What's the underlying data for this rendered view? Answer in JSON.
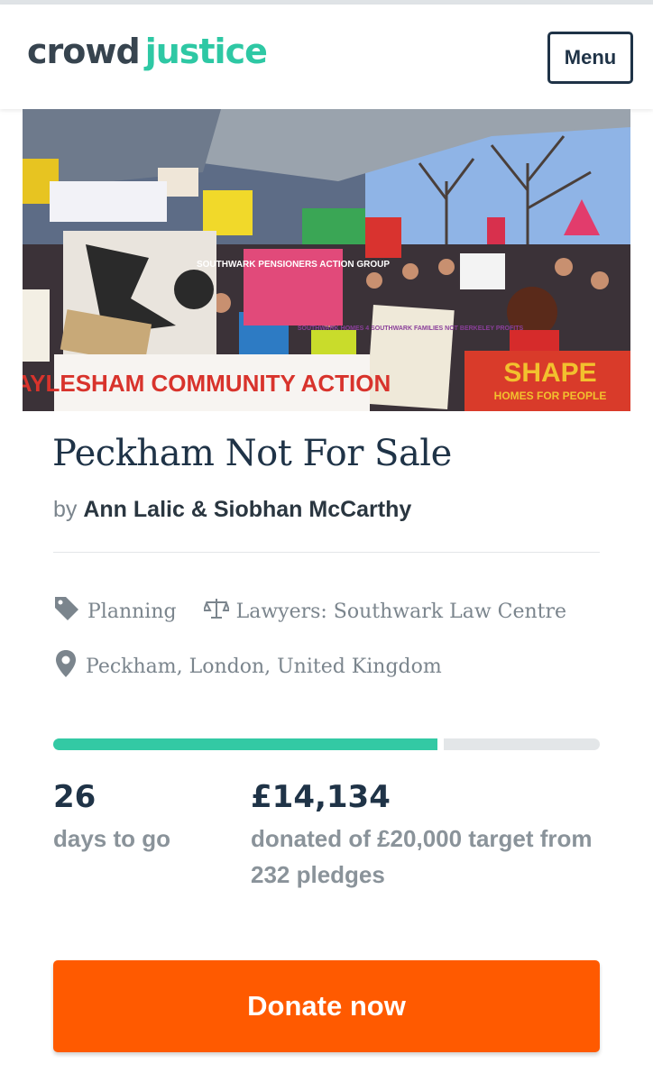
{
  "header": {
    "logo_part1": "crowd",
    "logo_part2": "justice",
    "menu_label": "Menu"
  },
  "hero": {
    "banner_aylesham": "AYLESHAM COMMUNITY ACTION",
    "banner_shape": "SHAPE",
    "banner_shape_sub": "HOMES FOR PEOPLE",
    "banner_pensioners": "SOUTHWARK PENSIONERS ACTION GROUP",
    "sign_southwark": "SOUTHWARK HOMES 4 SOUTHWARK FAMILIES NOT BERKELEY PROFITS"
  },
  "campaign": {
    "title": "Peckham Not For Sale",
    "by_prefix": "by",
    "authors": "Ann Lalic & Siobhan McCarthy",
    "category": "Planning",
    "lawyers": "Lawyers: Southwark Law Centre",
    "location": "Peckham, London, United Kingdom"
  },
  "funding": {
    "progress_fraction": 0.7067,
    "days_value": "26",
    "days_label": "days to go",
    "amount_value": "£14,134",
    "amount_label": "donated of £20,000 target from 232 pledges"
  },
  "cta": {
    "donate_label": "Donate now"
  },
  "colors": {
    "brand_teal": "#2ec8a4",
    "navy": "#1f3347",
    "donate_orange": "#ff5a00",
    "progress_track": "#e3e6e8"
  }
}
